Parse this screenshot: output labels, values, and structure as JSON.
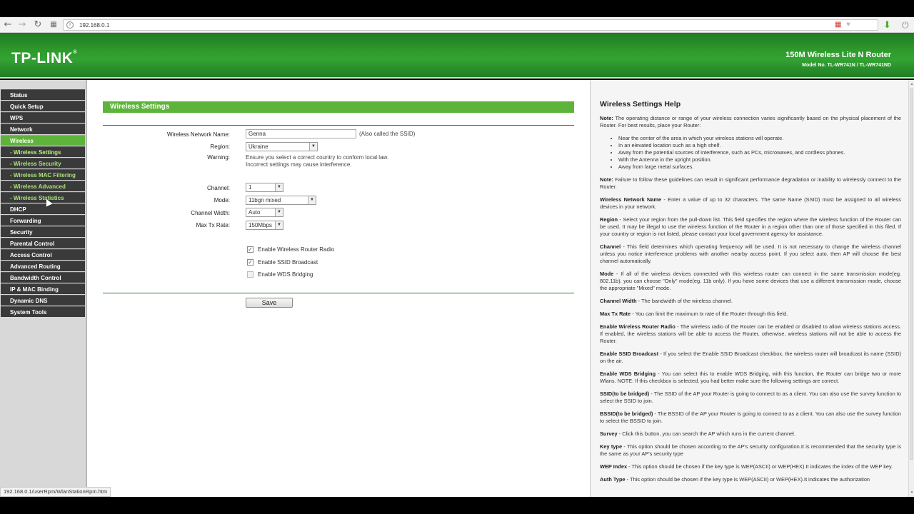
{
  "browser": {
    "url": "192.168.0.1",
    "status_url": "192.168.0.1/userRpm/WlanStationRpm.htm"
  },
  "header": {
    "logo": "TP-LINK",
    "logo_mark": "®",
    "product": "150M Wireless Lite N Router",
    "model": "Model No. TL-WR741N / TL-WR741ND"
  },
  "sidebar": {
    "items": [
      {
        "label": "Status"
      },
      {
        "label": "Quick Setup"
      },
      {
        "label": "WPS"
      },
      {
        "label": "Network"
      },
      {
        "label": "Wireless"
      },
      {
        "label": "- Wireless Settings"
      },
      {
        "label": "- Wireless Security"
      },
      {
        "label": "- Wireless MAC Filtering"
      },
      {
        "label": "- Wireless Advanced"
      },
      {
        "label": "- Wireless Statistics"
      },
      {
        "label": "DHCP"
      },
      {
        "label": "Forwarding"
      },
      {
        "label": "Security"
      },
      {
        "label": "Parental Control"
      },
      {
        "label": "Access Control"
      },
      {
        "label": "Advanced Routing"
      },
      {
        "label": "Bandwidth Control"
      },
      {
        "label": "IP & MAC Binding"
      },
      {
        "label": "Dynamic DNS"
      },
      {
        "label": "System Tools"
      }
    ]
  },
  "main": {
    "title": "Wireless Settings",
    "ssid": {
      "label": "Wireless Network Name:",
      "value": "Genna",
      "note": "(Also called the SSID)"
    },
    "region": {
      "label": "Region:",
      "value": "Ukraine"
    },
    "warning": {
      "label": "Warning:",
      "line1": "Ensure you select a correct country to conform local law.",
      "line2": "Incorrect settings may cause interference."
    },
    "channel": {
      "label": "Channel:",
      "value": "1"
    },
    "mode": {
      "label": "Mode:",
      "value": "11bgn mixed"
    },
    "channel_width": {
      "label": "Channel Width:",
      "value": "Auto"
    },
    "max_tx": {
      "label": "Max Tx Rate:",
      "value": "150Mbps"
    },
    "checkboxes": {
      "radio": {
        "label": "Enable Wireless Router Radio",
        "checked": true
      },
      "ssid_broadcast": {
        "label": "Enable SSID Broadcast",
        "checked": true
      },
      "wds": {
        "label": "Enable WDS Bridging",
        "checked": false
      }
    },
    "save_label": "Save"
  },
  "help": {
    "title": "Wireless Settings Help",
    "note1_label": "Note:",
    "note1_text": "The operating distance or range of your wireless connection varies significantly based on the physical placement of the Router. For best results, place your Router:",
    "bullets": [
      "Near the center of the area in which your wireless stations will operate.",
      "In an elevated location such as a high shelf.",
      "Away from the potential sources of interference, such as PCs, microwaves, and cordless phones.",
      "With the Antenna in the upright position.",
      "Away from large metal surfaces."
    ],
    "note2_label": "Note:",
    "note2_text": "Failure to follow these guidelines can result in significant performance degradation or inability to wirelessly connect to the Router.",
    "entries": [
      {
        "term": "Wireless Network Name",
        "text": " - Enter a value of up to 32 characters. The same Name (SSID) must be assigned to all wireless devices in your network."
      },
      {
        "term": "Region",
        "text": " - Select your region from the pull-down list. This field specifies the region where the wireless function of the Router can be used. It may be illegal to use the wireless function of the Router in a region other than one of those specified in this filed. If your country or region is not listed, please contact your local government agency for assistance."
      },
      {
        "term": "Channel",
        "text": " - This field determines which operating frequency will be used. It is not necessary to change the wireless channel unless you notice interference problems with another nearby access point. If you select auto, then AP will choose the best channel automatically."
      },
      {
        "term": "Mode",
        "text": " - If all of the wireless devices connected with this wireless router can connect in the same transmission mode(eg. 802.11b), you can choose \"Only\" mode(eg. 11b only). If you have some devices that use a different transmission mode, choose the appropriate \"Mixed\" mode."
      },
      {
        "term": "Channel Width",
        "text": " - The bandwidth of the wireless channel."
      },
      {
        "term": "Max Tx Rate",
        "text": " - You can limit the maximum tx rate of the Router through this field."
      },
      {
        "term": "Enable Wireless Router Radio",
        "text": " - The wireless radio of the Router can be enabled or disabled to allow wireless stations access. If enabled, the wireless stations will be able to access the Router, otherwise, wireless stations will not be able to access the Router."
      },
      {
        "term": "Enable SSID Broadcast",
        "text": " - If you select the Enable SSID Broadcast checkbox, the wireless router will broadcast its name (SSID) on the air."
      },
      {
        "term": "Enable WDS Bridging",
        "text": " - You can select this to enable WDS Bridging, with this function, the Router can bridge two or more Wlans. NOTE: If this checkbox is selected, you had better make sure the following settings are correct."
      },
      {
        "term": "SSID(to be bridged)",
        "text": " - The SSID of the AP your Router is going to connect to as a client. You can also use the survey function to select the SSID to join."
      },
      {
        "term": "BSSID(to be bridged)",
        "text": " - The BSSID of the AP your Router is going to connect to as a client. You can also use the survey function to select the BSSID to join."
      },
      {
        "term": "Survey",
        "text": " - Click this button, you can search the AP which runs in the current channel."
      },
      {
        "term": "Key type",
        "text": " - This option should be chosen according to the AP's security configuration.It is recommended that the security type is the same as your AP's security type"
      },
      {
        "term": "WEP Index",
        "text": " - This option should be chosen if the key type is WEP(ASCII) or WEP(HEX).It indicates the index of the WEP key."
      },
      {
        "term": "Auth Type",
        "text": " - This option should be chosen if the key type is WEP(ASCII) or WEP(HEX).It indicates the authorization"
      }
    ]
  }
}
